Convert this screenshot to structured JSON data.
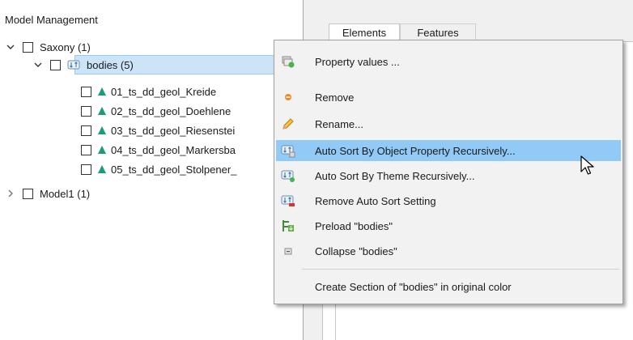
{
  "panel": {
    "title": "Model Management"
  },
  "tree": {
    "saxony": "Saxony (1)",
    "bodies": "bodies (5)",
    "children": [
      "01_ts_dd_geol_Kreide",
      "02_ts_dd_geol_Doehlene",
      "03_ts_dd_geol_Riesenstei",
      "04_ts_dd_geol_Markersba",
      "05_ts_dd_geol_Stolpener_"
    ],
    "model1": "Model1 (1)"
  },
  "tabs": {
    "elements": "Elements",
    "features": "Features"
  },
  "menu": {
    "items": [
      {
        "label": "Property values ...",
        "icon": "property-values-icon"
      },
      {
        "label": "Remove",
        "icon": "remove-dot-icon"
      },
      {
        "label": "Rename...",
        "icon": "pencil-icon"
      },
      {
        "label": "Auto Sort By Object Property Recursively...",
        "icon": "auto-sort-property-icon",
        "highlighted": true
      },
      {
        "label": "Auto Sort By Theme Recursively...",
        "icon": "auto-sort-theme-icon"
      },
      {
        "label": "Remove Auto Sort Setting",
        "icon": "remove-sort-icon"
      },
      {
        "label": "Preload \"bodies\"",
        "icon": "preload-icon"
      },
      {
        "label": "Collapse \"bodies\"",
        "icon": "collapse-icon"
      },
      {
        "label": "Create Section of \"bodies\" in original color",
        "icon": ""
      }
    ]
  },
  "colors": {
    "selection": "#cce4f7",
    "highlight": "#91c9f7",
    "triangle": "#1e9a7a"
  }
}
